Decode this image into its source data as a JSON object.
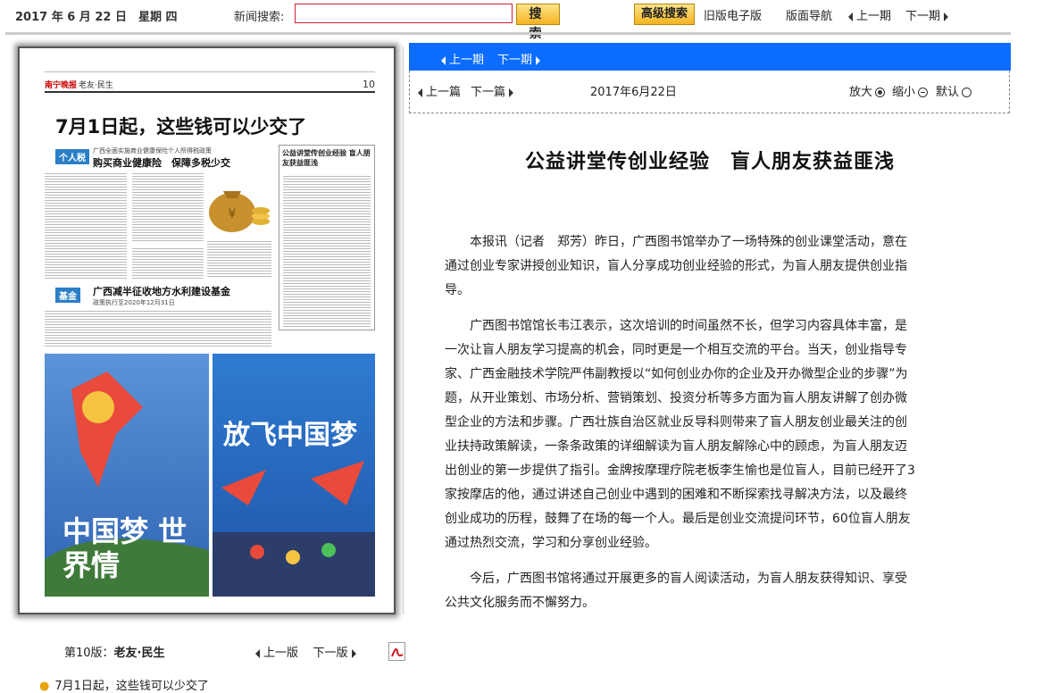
{
  "topbar": {
    "date": "2017 年 6 月 22 日　星期 四",
    "search_label": "新闻搜索:",
    "search_value": "",
    "search_button": "搜 索",
    "advanced_search": "高级搜索",
    "old_version": "旧版电子版",
    "page_nav": "版面导航",
    "prev_issue": "上一期",
    "next_issue": "下一期"
  },
  "newspaper_page": {
    "header_left": "南宁晚报",
    "header_section": "老友·民生",
    "page_no": "10",
    "headline": "7月1日起，这些钱可以少交了",
    "tag1": "个人税",
    "subhead1": "广西全面实施商业健康保险个人所得税政策",
    "headline2": "购买商业健康险　保障多税少交",
    "side_headline": "公益讲堂传创业经验 盲人朋友获益匪浅",
    "tag2": "基金",
    "headline3": "广西减半征收地方水利建设基金",
    "subhead3": "政策执行至2020年12月31日",
    "poster1_text": "中国梦 世界情",
    "poster2_text": "放飞中国梦"
  },
  "left_footer": {
    "page_label_prefix": "第10版：",
    "page_label_name": "老友·民生",
    "prev": "上一版",
    "next": "下一版",
    "article_link": "7月1日起，这些钱可以少交了"
  },
  "bluebar": {
    "prev_issue": "上一期",
    "next_issue": "下一期"
  },
  "article_toolbar": {
    "prev_article": "上一篇",
    "next_article": "下一篇",
    "date": "2017年6月22日",
    "zoom_in": "放大",
    "zoom_out": "缩小",
    "default": "默认"
  },
  "article": {
    "title": "公益讲堂传创业经验　盲人朋友获益匪浅",
    "paragraphs": [
      "本报讯（记者　郑芳）昨日，广西图书馆举办了一场特殊的创业课堂活动，意在通过创业专家讲授创业知识，盲人分享成功创业经验的形式，为盲人朋友提供创业指导。",
      "广西图书馆馆长韦江表示，这次培训的时间虽然不长，但学习内容具体丰富，是一次让盲人朋友学习提高的机会，同时更是一个相互交流的平台。当天，创业指导专家、广西金融技术学院严伟副教授以“如何创业办你的企业及开办微型企业的步骤”为题，从开业策划、市场分析、营销策划、投资分析等多方面为盲人朋友讲解了创办微型企业的方法和步骤。广西壮族自治区就业反导科则带来了盲人朋友创业最关注的创业扶持政策解读，一条条政策的详细解读为盲人朋友解除心中的顾虑，为盲人朋友迈出创业的第一步提供了指引。金牌按摩理疗院老板李生愉也是位盲人，目前已经开了3家按摩店的他，通过讲述自己创业中遇到的困难和不断探索找寻解决方法，以及最终创业成功的历程，鼓舞了在场的每一个人。最后是创业交流提问环节，60位盲人朋友通过热烈交流，学习和分享创业经验。",
      "今后，广西图书馆将通过开展更多的盲人阅读活动，为盲人朋友获得知识、享受公共文化服务而不懈努力。"
    ]
  }
}
